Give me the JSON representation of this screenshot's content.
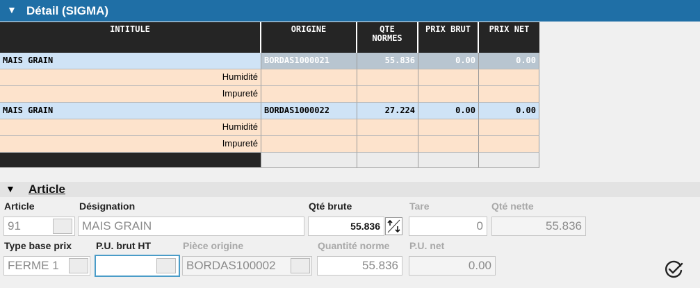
{
  "panel": {
    "title": "Détail (SIGMA)",
    "collapse_icon": "triangle-down-icon"
  },
  "grid": {
    "columns": [
      "INTITULE",
      "ORIGINE",
      "QTE NORMES",
      "PRIX BRUT",
      "PRIX NET"
    ],
    "rows": [
      {
        "type": "main",
        "intitule": "MAIS GRAIN",
        "origine": "BORDAS1000021",
        "qte": "55.836",
        "prix_brut": "0.00",
        "prix_net": "0.00"
      },
      {
        "type": "sub",
        "intitule": "Humidité"
      },
      {
        "type": "sub",
        "intitule": "Impureté"
      },
      {
        "type": "main",
        "intitule": "MAIS GRAIN",
        "origine": "BORDAS1000022",
        "qte": "27.224",
        "prix_brut": "0.00",
        "prix_net": "0.00"
      },
      {
        "type": "sub",
        "intitule": "Humidité"
      },
      {
        "type": "sub",
        "intitule": "Impureté"
      }
    ]
  },
  "article": {
    "section_title": "Article",
    "labels": {
      "article": "Article",
      "designation": "Désignation",
      "qte_brute": "Qté brute",
      "tare": "Tare",
      "qte_nette": "Qté nette",
      "type_base_prix": "Type base prix",
      "pu_brut_ht": "P.U. brut HT",
      "piece_origine": "Pièce origine",
      "quantite_norme": "Quantité norme",
      "pu_net": "P.U. net"
    },
    "values": {
      "article": "91",
      "designation": "MAIS GRAIN",
      "qte_brute": "55.836",
      "tare": "0",
      "qte_nette": "55.836",
      "type_base_prix": "FERME 1",
      "pu_brut_ht": "",
      "piece_origine": "BORDAS100002",
      "quantite_norme": "55.836",
      "pu_net": "0.00"
    }
  },
  "icons": {
    "spinner": "up-down-arrows-icon",
    "validate": "check-circle-icon"
  }
}
